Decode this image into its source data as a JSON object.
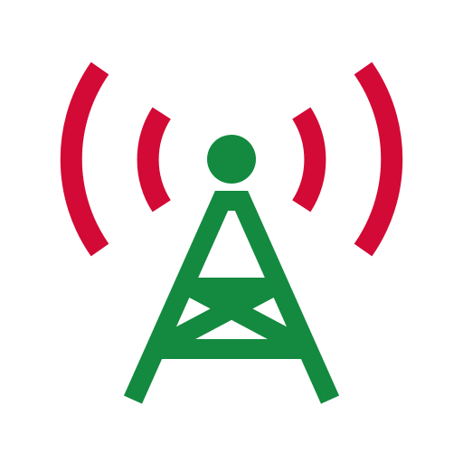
{
  "icon": {
    "name": "radio-tower-icon",
    "colors": {
      "background": "#ffffff",
      "waves": "#d20a35",
      "tower": "#138a3f"
    }
  }
}
